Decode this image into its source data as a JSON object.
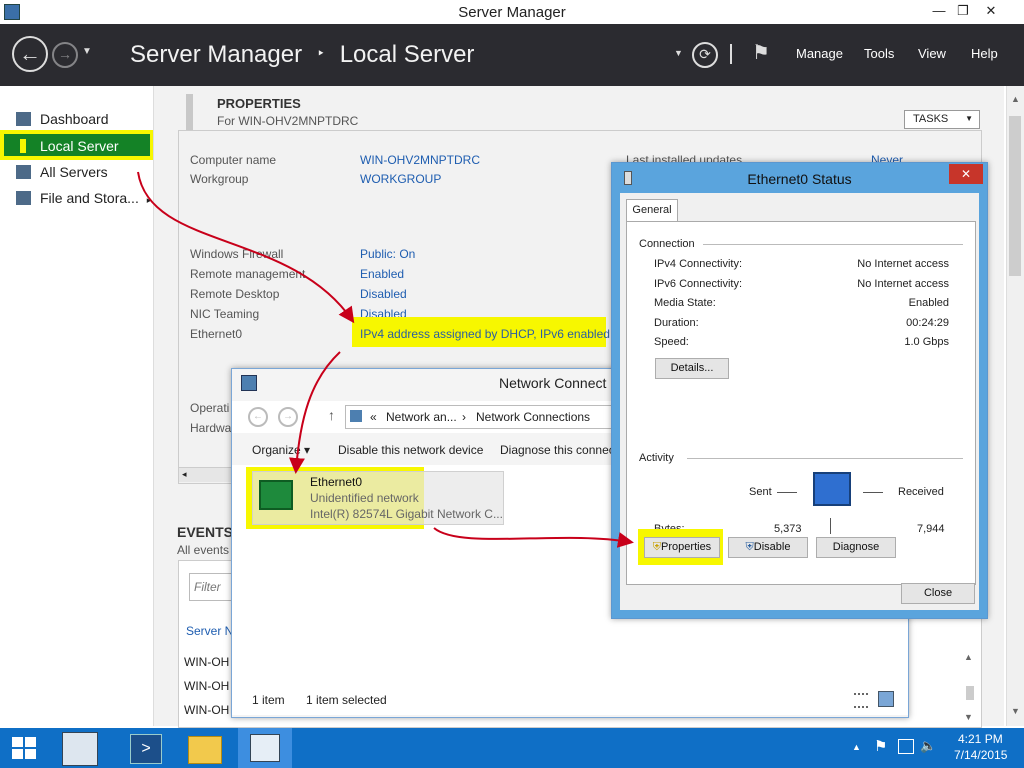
{
  "window": {
    "title": "Server Manager",
    "minimize": "—",
    "restore": "❐",
    "close": "✕"
  },
  "header": {
    "app": "Server Manager",
    "separator": "‣",
    "page": "Local Server",
    "menu": [
      "Manage",
      "Tools",
      "View",
      "Help"
    ]
  },
  "sidebar": {
    "items": [
      {
        "label": "Dashboard"
      },
      {
        "label": "Local Server"
      },
      {
        "label": "All Servers"
      },
      {
        "label": "File and Stora..."
      }
    ]
  },
  "properties": {
    "heading": "PROPERTIES",
    "subheading": "For WIN-OHV2MNPTDRC",
    "tasks": "TASKS",
    "rows": [
      {
        "label": "Computer name",
        "value": "WIN-OHV2MNPTDRC"
      },
      {
        "label": "Workgroup",
        "value": "WORKGROUP"
      },
      {
        "label": "Windows Firewall",
        "value": "Public: On"
      },
      {
        "label": "Remote management",
        "value": "Enabled"
      },
      {
        "label": "Remote Desktop",
        "value": "Disabled"
      },
      {
        "label": "NIC Teaming",
        "value": "Disabled"
      },
      {
        "label": "Ethernet0",
        "value": "IPv4 address assigned by DHCP, IPv6 enabled"
      }
    ],
    "last_updates_label": "Last installed updates",
    "last_updates_value": "Never",
    "partial_labels": [
      "Operati",
      "Hardwa"
    ]
  },
  "events": {
    "heading": "EVENTS",
    "sub": "All events",
    "filter_placeholder": "Filter",
    "col": "Server N",
    "rows": [
      "WIN-OH",
      "WIN-OH",
      "WIN-OH"
    ]
  },
  "netconn": {
    "title": "Network Connect",
    "address": [
      "«",
      "Network an...",
      "›",
      "Network Connections"
    ],
    "toolbar": [
      "Organize ▾",
      "Disable this network device",
      "Diagnose this connec"
    ],
    "adapter": {
      "name": "Ethernet0",
      "status": "Unidentified network",
      "device": "Intel(R) 82574L Gigabit Network C..."
    },
    "statusbar": [
      "1 item",
      "1 item selected"
    ]
  },
  "eth_status": {
    "title": "Ethernet0 Status",
    "tab": "General",
    "connection_header": "Connection",
    "connection_rows": [
      {
        "label": "IPv4 Connectivity:",
        "value": "No Internet access"
      },
      {
        "label": "IPv6 Connectivity:",
        "value": "No Internet access"
      },
      {
        "label": "Media State:",
        "value": "Enabled"
      },
      {
        "label": "Duration:",
        "value": "00:24:29"
      },
      {
        "label": "Speed:",
        "value": "1.0 Gbps"
      }
    ],
    "details_button": "Details...",
    "activity_header": "Activity",
    "sent_label": "Sent",
    "received_label": "Received",
    "bytes_label": "Bytes:",
    "bytes_sent": "5,373",
    "bytes_received": "7,944",
    "buttons": [
      "Properties",
      "Disable",
      "Diagnose"
    ],
    "close_button": "Close"
  },
  "taskbar": {
    "time": "4:21 PM",
    "date": "7/14/2015"
  },
  "colors": {
    "header_bg": "#2b2b30",
    "highlight": "#f7f700",
    "link": "#1e5db0",
    "taskbar": "#0f6fc6",
    "annotation_arrow": "#c8001a"
  }
}
